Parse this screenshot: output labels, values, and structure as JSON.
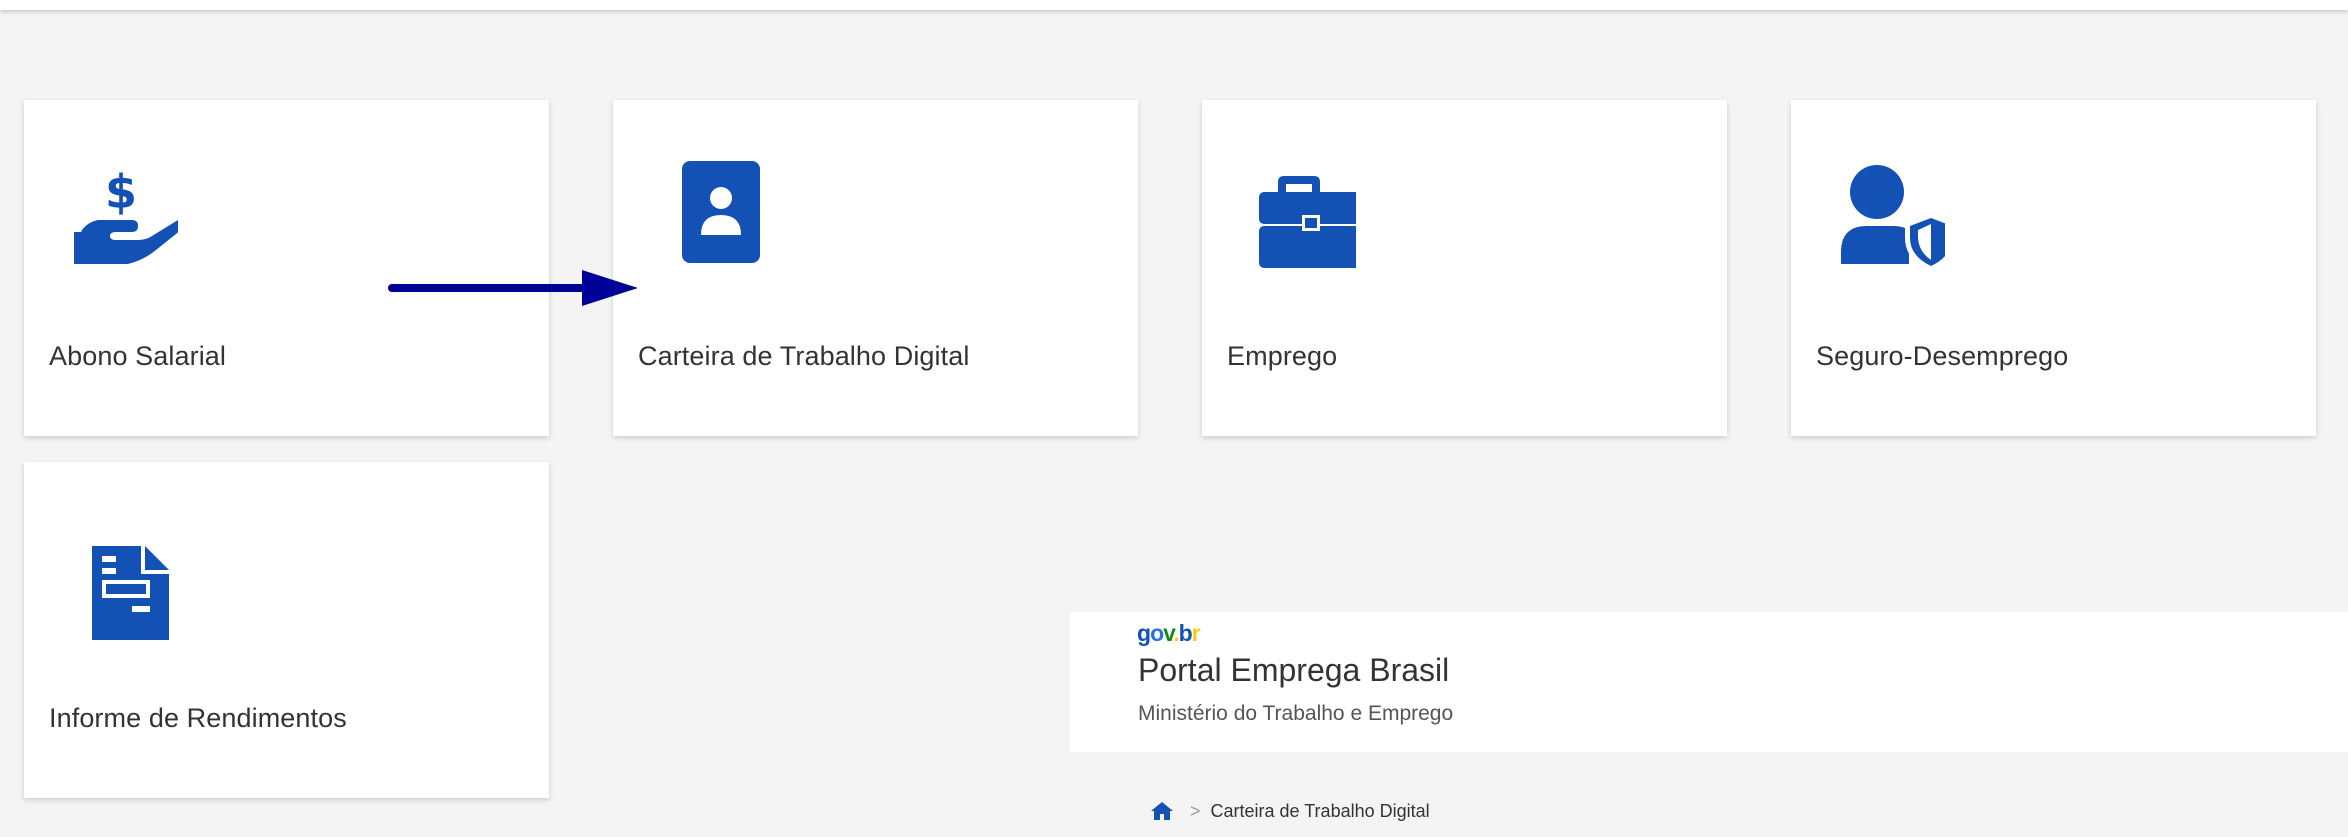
{
  "cards": [
    {
      "label": "Abono Salarial",
      "icon": "hand-dollar-icon"
    },
    {
      "label": "Carteira de Trabalho Digital",
      "icon": "id-card-icon"
    },
    {
      "label": "Emprego",
      "icon": "briefcase-icon"
    },
    {
      "label": "Seguro-Desemprego",
      "icon": "user-shield-icon"
    },
    {
      "label": "Informe de Rendimentos",
      "icon": "document-icon"
    }
  ],
  "annotation": {
    "arrow_color": "#000099"
  },
  "colors": {
    "icon_blue": "#1351b4",
    "background": "#f4f4f4",
    "card": "#ffffff",
    "text": "#333333"
  },
  "header": {
    "logo_text": "gov.br",
    "title": "Portal Emprega Brasil",
    "subtitle": "Ministério do Trabalho e Emprego"
  },
  "breadcrumb": {
    "separator": ">",
    "current": "Carteira de Trabalho Digital"
  }
}
